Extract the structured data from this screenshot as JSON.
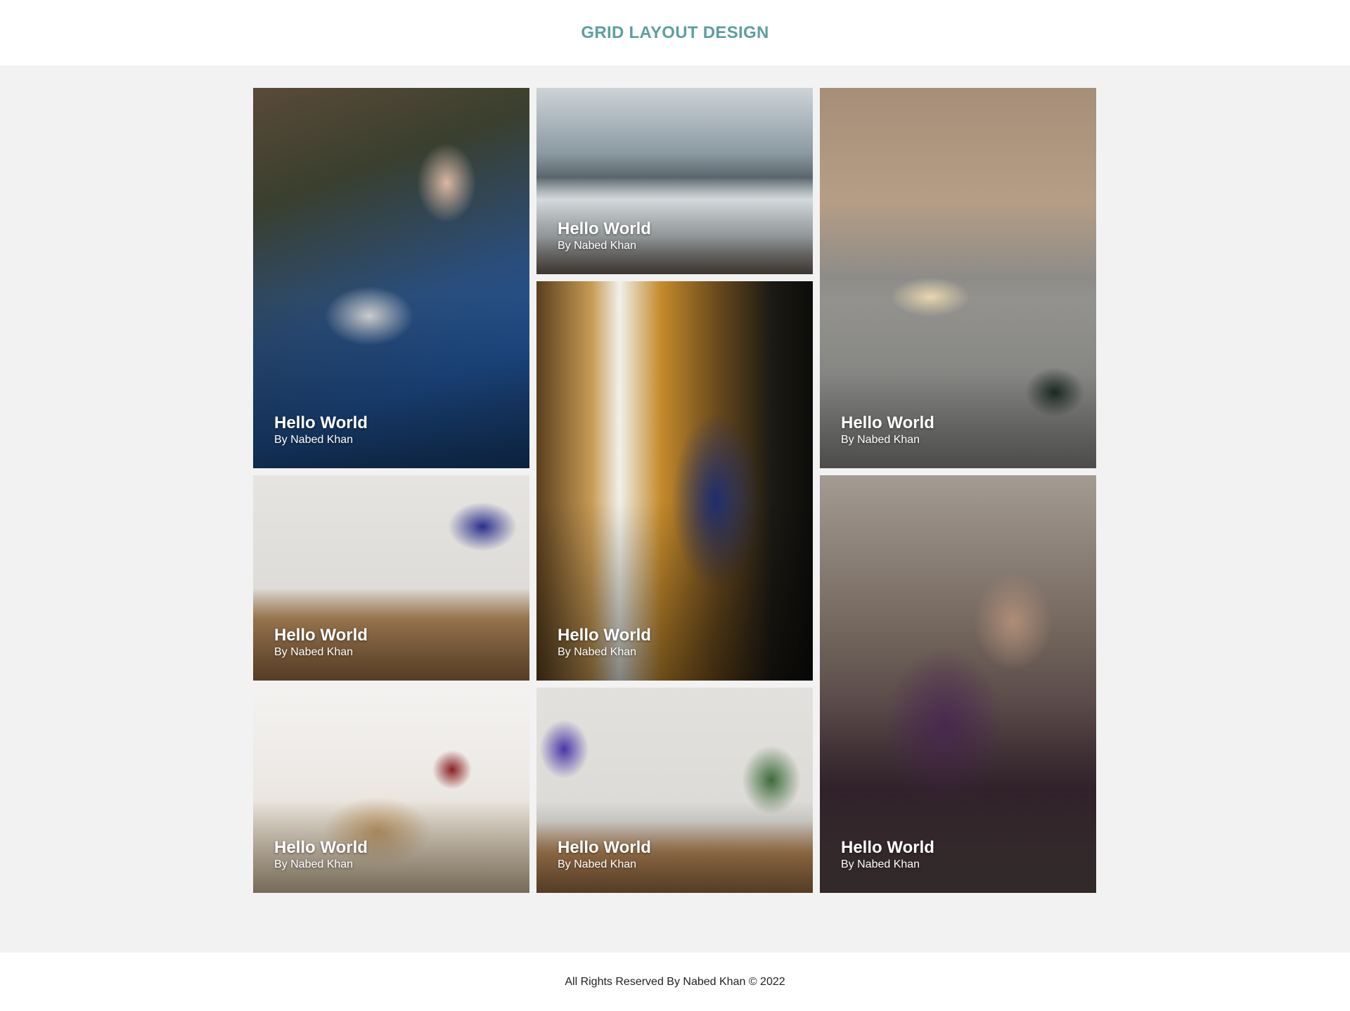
{
  "header": {
    "title": "GRID LAYOUT DESIGN"
  },
  "cards": [
    {
      "title": "Hello World",
      "author": "By Nabed Khan",
      "photo": "woman-with-laptop-picnic"
    },
    {
      "title": "Hello World",
      "author": "By Nabed Khan",
      "photo": "car-on-snowy-road"
    },
    {
      "title": "Hello World",
      "author": "By Nabed Khan",
      "photo": "picnic-blanket-food-feet"
    },
    {
      "title": "Hello World",
      "author": "By Nabed Khan",
      "photo": "desk-microphone-monitor"
    },
    {
      "title": "Hello World",
      "author": "By Nabed Khan",
      "photo": "woman-by-window"
    },
    {
      "title": "Hello World",
      "author": "By Nabed Khan",
      "photo": "lilac-flowers-hand"
    },
    {
      "title": "Hello World",
      "author": "By Nabed Khan",
      "photo": "toast-cutting-board"
    },
    {
      "title": "Hello World",
      "author": "By Nabed Khan",
      "photo": "desk-headphones-plant"
    }
  ],
  "footer": {
    "copyright": "All Rights Reserved By Nabed Khan © 2022"
  },
  "colors": {
    "title": "#5f9ea0",
    "page_background": "#f2f2f2",
    "bar_background": "#ffffff"
  }
}
